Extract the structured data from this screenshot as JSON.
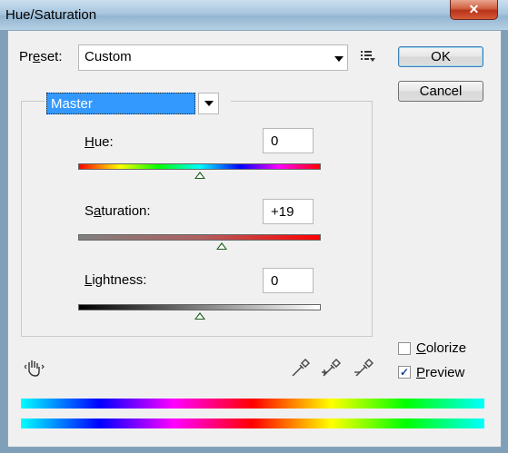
{
  "window": {
    "title": "Hue/Saturation",
    "close_glyph": "✕"
  },
  "preset": {
    "label_pre": "Pr",
    "label_mnemonic": "e",
    "label_post": "set:",
    "value": "Custom",
    "menu_icon": "preset-options-icon"
  },
  "buttons": {
    "ok": "OK",
    "cancel": "Cancel"
  },
  "channel": {
    "value": "Master"
  },
  "hue": {
    "label_mnemonic": "H",
    "label_post": "ue:",
    "value": "0",
    "level": 0
  },
  "saturation": {
    "label_pre": "S",
    "label_mnemonic": "a",
    "label_post": "turation:",
    "value": "+19",
    "level": 19
  },
  "lightness": {
    "label_pre": "",
    "label_mnemonic": "L",
    "label_post": "ightness:",
    "value": "0",
    "level": 0
  },
  "options": {
    "colorize": {
      "label_mnemonic": "C",
      "label_post": "olorize",
      "checked": false
    },
    "preview": {
      "label_mnemonic": "P",
      "label_post": "review",
      "checked": true,
      "check_glyph": "✓"
    }
  },
  "icons": [
    "hand-adjust-icon",
    "eyedropper-icon",
    "eyedropper-plus-icon",
    "eyedropper-minus-icon"
  ],
  "colors": {
    "accent_selected": "#3399ff",
    "close_red": "#c8452a"
  }
}
